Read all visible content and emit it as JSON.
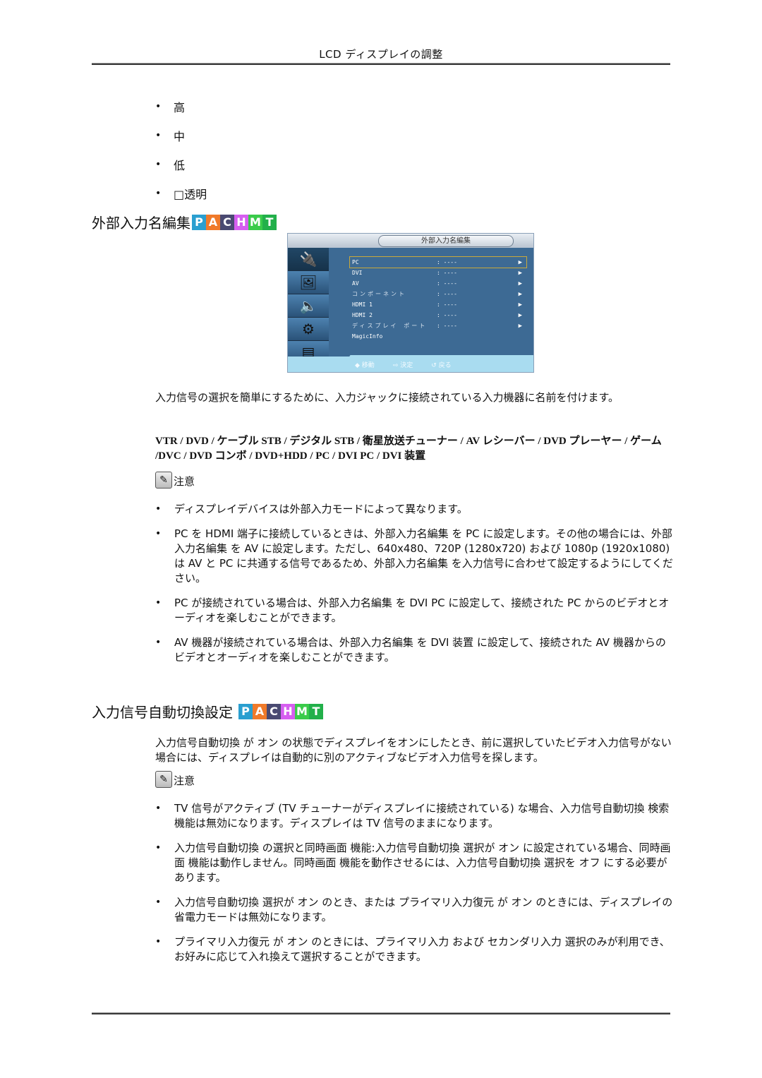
{
  "header": {
    "title": "LCD ディスプレイの調整"
  },
  "options": [
    "高",
    "中",
    "低",
    "□透明"
  ],
  "section1": {
    "title": "外部入力名編集",
    "badges": [
      {
        "letter": "P",
        "color": "#2a9fd0"
      },
      {
        "letter": "A",
        "color": "#f07a2a"
      },
      {
        "letter": "C",
        "color": "#4a4a72"
      },
      {
        "letter": "H",
        "color": "#d65ef0"
      },
      {
        "letter": "M",
        "color": "#3acb4a"
      },
      {
        "letter": "T",
        "color": "#22b04a"
      }
    ],
    "osd": {
      "title": "外部入力名編集",
      "side_icons": [
        "input-icon",
        "picture-icon",
        "sound-icon",
        "setup-icon",
        "multi-control-icon"
      ],
      "rows": [
        {
          "label": "PC",
          "value": ": ----",
          "arrow": "▶",
          "selected": true
        },
        {
          "label": "DVI",
          "value": ": ----",
          "arrow": "▶"
        },
        {
          "label": "AV",
          "value": ": ----",
          "arrow": "▶"
        },
        {
          "label": "コンポーネント",
          "value": ": ----",
          "arrow": "▶"
        },
        {
          "label": "HDMI 1",
          "value": ": ----",
          "arrow": "▶"
        },
        {
          "label": "HDMI 2",
          "value": ": ----",
          "arrow": "▶"
        },
        {
          "label": "ディスプレイ ポート",
          "value": ": ----",
          "arrow": "▶"
        },
        {
          "label": "MagicInfo",
          "value": "",
          "arrow": ""
        }
      ],
      "help": [
        {
          "icon": "◆",
          "label": "移動"
        },
        {
          "icon": "⇨",
          "label": "決定"
        },
        {
          "icon": "↺",
          "label": "戻る"
        }
      ]
    },
    "description": "入力信号の選択を簡単にするために、入力ジャックに接続されている入力機器に名前を付けます。",
    "devices": "VTR / DVD / ケーブル STB / デジタル STB / 衛星放送チューナー / AV レシーバー / DVD プレーヤー / ゲーム /DVC / DVD コンボ / DVD+HDD / PC / DVI PC / DVI 装置",
    "note_label": "注意",
    "notes": [
      "ディスプレイデバイスは外部入力モードによって異なります。",
      "PC を HDMI 端子に接続しているときは、外部入力名編集 を PC に設定します。その他の場合には、外部入力名編集 を AV に設定します。ただし、640x480、720P (1280x720) および 1080p (1920x1080) は AV と PC に共通する信号であるため、外部入力名編集 を入力信号に合わせて設定するようにしてください。",
      "PC が接続されている場合は、外部入力名編集 を DVI PC に設定して、接続された PC からのビデオとオーディオを楽しむことができます。",
      "AV 機器が接続されている場合は、外部入力名編集 を DVI 装置 に設定して、接続された AV 機器からのビデオとオーディオを楽しむことができます。"
    ]
  },
  "section2": {
    "title": "入力信号自動切換設定",
    "description": "入力信号自動切換 が オン の状態でディスプレイをオンにしたとき、前に選択していたビデオ入力信号がない場合には、ディスプレイは自動的に別のアクティブなビデオ入力信号を探します。",
    "note_label": "注意",
    "notes": [
      "TV 信号がアクティブ (TV チューナーがディスプレイに接続されている) な場合、入力信号自動切換 検索機能は無効になります。ディスプレイは TV 信号のままになります。",
      "入力信号自動切換 の選択と同時画面 機能:入力信号自動切換 選択が オン に設定されている場合、同時画面 機能は動作しません。同時画面 機能を動作させるには、入力信号自動切換 選択を オフ にする必要があります。",
      "入力信号自動切換 選択が オン のとき、または プライマリ入力復元 が オン のときには、ディスプレイの省電力モードは無効になります。",
      "プライマリ入力復元 が オン のときには、プライマリ入力 および セカンダリ入力 選択のみが利用でき、お好みに応じて入れ換えて選択することができます。"
    ]
  },
  "bullet_glyph": "•"
}
